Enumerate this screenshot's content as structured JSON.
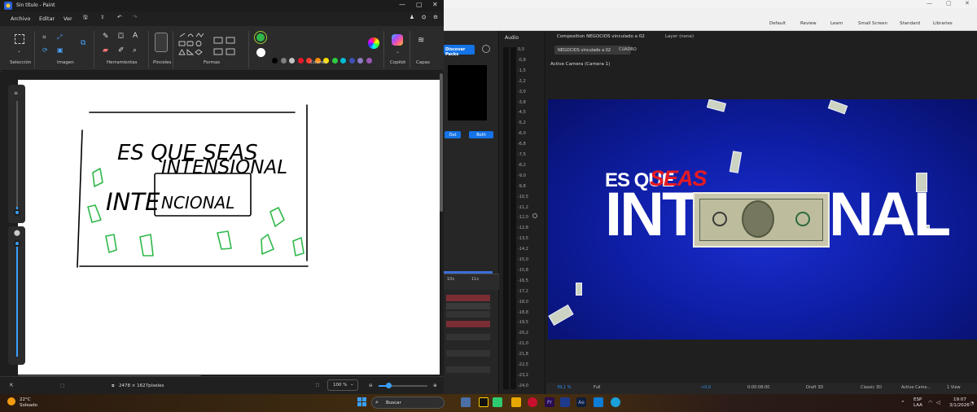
{
  "paint": {
    "title": "Sin título - Paint",
    "menu": [
      "Archivo",
      "Editar",
      "Ver"
    ],
    "ribbon_groups": [
      "Selección",
      "Imagen",
      "Herramientas",
      "Pinceles",
      "Formas",
      "Colores",
      "Copilot",
      "Capas"
    ],
    "palette": [
      "#000000",
      "#7f7f7f",
      "#c3c3c3",
      "#e6192b",
      "#ff3b30",
      "#ff8c00",
      "#ffe100",
      "#2ecc40",
      "#00bcd4",
      "#3f51b5",
      "#8e7cc3",
      "#9b59b6"
    ],
    "current_color": "#2fb84a",
    "secondary_color": "#ffffff",
    "canvas_size": "2478 × 1627píxeles",
    "zoom": "100 %",
    "drawing": {
      "line1": "ES QUE SEAS",
      "line2": "INTENSIONAL",
      "line3_prefix": "INTE",
      "line3_box": "NCIONAL"
    }
  },
  "ae": {
    "workspaces": [
      "Default",
      "Review",
      "Learn",
      "Small Screen",
      "Standard",
      "Libraries"
    ],
    "discover_label": "Discover Packs",
    "out_label": "Out",
    "both_label": "Both",
    "timeline_ticks": [
      "10s",
      "11s"
    ],
    "audio_title": "Audio",
    "db_scale": [
      "0,0",
      "-0,8",
      "-1,5",
      "-2,2",
      "-3,0",
      "-3,8",
      "-4,5",
      "-5,2",
      "-6,0",
      "-6,8",
      "-7,5",
      "-8,2",
      "-9,0",
      "-9,8",
      "-10,5",
      "-11,2",
      "-12,0",
      "-12,8",
      "-13,5",
      "-14,2",
      "-15,0",
      "-15,8",
      "-16,5",
      "-17,2",
      "-18,0",
      "-18,8",
      "-19,5",
      "-20,2",
      "-21,0",
      "-21,8",
      "-22,5",
      "-23,2",
      "-24,0"
    ],
    "comp_title": "Composition NEGOCIOS vinculado a 02",
    "layer_title": "Layer (none)",
    "comp_tab": "NEGOCIOS vinculado a 02",
    "comp_tab2": "CUADRO",
    "active_camera": "Active Camera (Camera 1)",
    "viewer_text1a": "ES QUE",
    "viewer_text1b": "SEAS",
    "viewer_text2a": "INTE",
    "viewer_text2b": "NAL",
    "footer": {
      "zoom": "39,1 %",
      "quality": "Full",
      "exposure": "+0,0",
      "timecode": "0:00:08:00",
      "draft": "Draft 3D",
      "renderer": "Classic 3D",
      "camera": "Active Came...",
      "views": "1 View"
    }
  },
  "taskbar": {
    "temperature": "22°C",
    "weather": "Soleado",
    "search_placeholder": "Buscar",
    "lang1": "ESP",
    "lang2": "LAA",
    "time": "19:07",
    "date": "3/1/2026"
  }
}
